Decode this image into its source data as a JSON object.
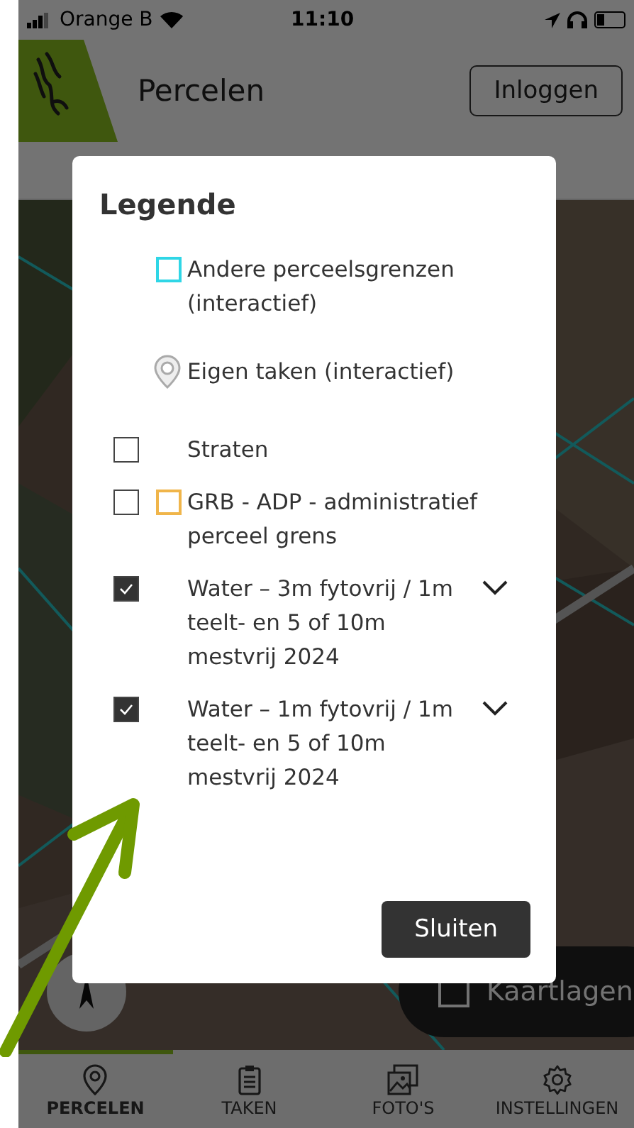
{
  "status_bar": {
    "carrier": "Orange B",
    "time": "11:10"
  },
  "header": {
    "title": "Percelen",
    "login_button": "Inloggen"
  },
  "map": {
    "layers_button": "Kaartlagen"
  },
  "legend": {
    "title": "Legende",
    "items": [
      {
        "kind": "outline",
        "color": "#2fd6e6",
        "label": "Andere perceelsgrenzen (interactief)"
      },
      {
        "kind": "pin",
        "label": "Eigen taken (interactief)"
      },
      {
        "kind": "toggle",
        "checked": false,
        "label": "Straten"
      },
      {
        "kind": "toggle",
        "checked": false,
        "color": "#f0b54a",
        "label": "GRB - ADP - administratief perceel grens"
      },
      {
        "kind": "toggle",
        "checked": true,
        "expanded": false,
        "label": "Water – 3m fytovrij / 1m teelt- en 5 of 10m mestvrij 2024"
      },
      {
        "kind": "toggle",
        "checked": true,
        "expanded": false,
        "label": "Water – 1m fytovrij / 1m teelt- en 5 of 10m mestvrij 2024"
      }
    ],
    "close_button": "Sluiten"
  },
  "nav": [
    {
      "kind": "pin",
      "label": "PERCELEN",
      "selected": true
    },
    {
      "kind": "clipboard",
      "label": "TAKEN",
      "selected": false
    },
    {
      "kind": "photos",
      "label": "FOTO'S",
      "selected": false
    },
    {
      "kind": "gear",
      "label": "INSTELLINGEN",
      "selected": false
    }
  ]
}
